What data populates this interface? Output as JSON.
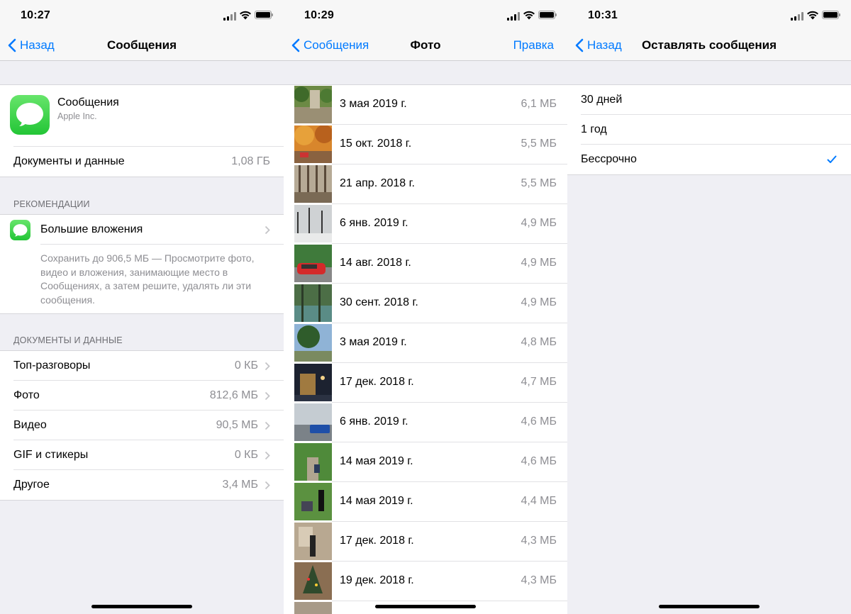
{
  "screens": [
    {
      "time": "10:27",
      "back": "Назад",
      "title": "Сообщения",
      "app": {
        "name": "Сообщения",
        "vendor": "Apple Inc.",
        "icon": "messages-icon"
      },
      "docs_row": {
        "label": "Документы и данные",
        "value": "1,08 ГБ"
      },
      "recommendations_header": "РЕКОМЕНДАЦИИ",
      "recommendation": {
        "title": "Большие вложения",
        "description": "Сохранить до 906,5 МБ — Просмотрите фото, видео и вложения, занимающие место в Сообщениях, а затем решите, удалять ли эти сообщения."
      },
      "docs_header": "ДОКУМЕНТЫ И ДАННЫЕ",
      "items": [
        {
          "label": "Топ-разговоры",
          "value": "0 КБ"
        },
        {
          "label": "Фото",
          "value": "812,6 МБ"
        },
        {
          "label": "Видео",
          "value": "90,5 МБ"
        },
        {
          "label": "GIF и стикеры",
          "value": "0 КБ"
        },
        {
          "label": "Другое",
          "value": "3,4 МБ"
        }
      ]
    },
    {
      "time": "10:29",
      "back": "Сообщения",
      "title": "Фото",
      "edit": "Правка",
      "photos": [
        {
          "date": "3 мая 2019 г.",
          "size": "6,1 МБ"
        },
        {
          "date": "15 окт. 2018 г.",
          "size": "5,5 МБ"
        },
        {
          "date": "21 апр. 2018 г.",
          "size": "5,5 МБ"
        },
        {
          "date": "6 янв. 2019 г.",
          "size": "4,9 МБ"
        },
        {
          "date": "14 авг. 2018 г.",
          "size": "4,9 МБ"
        },
        {
          "date": "30 сент. 2018 г.",
          "size": "4,9 МБ"
        },
        {
          "date": "3 мая 2019 г.",
          "size": "4,8 МБ"
        },
        {
          "date": "17 дек. 2018 г.",
          "size": "4,7 МБ"
        },
        {
          "date": "6 янв. 2019 г.",
          "size": "4,6 МБ"
        },
        {
          "date": "14 мая 2019 г.",
          "size": "4,6 МБ"
        },
        {
          "date": "14 мая 2019 г.",
          "size": "4,4 МБ"
        },
        {
          "date": "17 дек. 2018 г.",
          "size": "4,3 МБ"
        },
        {
          "date": "19 дек. 2018 г.",
          "size": "4,3 МБ"
        }
      ]
    },
    {
      "time": "10:31",
      "back": "Назад",
      "title": "Оставлять сообщения",
      "options": [
        {
          "label": "30 дней",
          "selected": false
        },
        {
          "label": "1 год",
          "selected": false
        },
        {
          "label": "Бессрочно",
          "selected": true
        }
      ],
      "checkmark": "checkmark-icon"
    }
  ],
  "colors": {
    "accent": "#007aff",
    "background": "#efeff4",
    "secondary_text": "#8e8e93",
    "app_green": "#34c759"
  }
}
